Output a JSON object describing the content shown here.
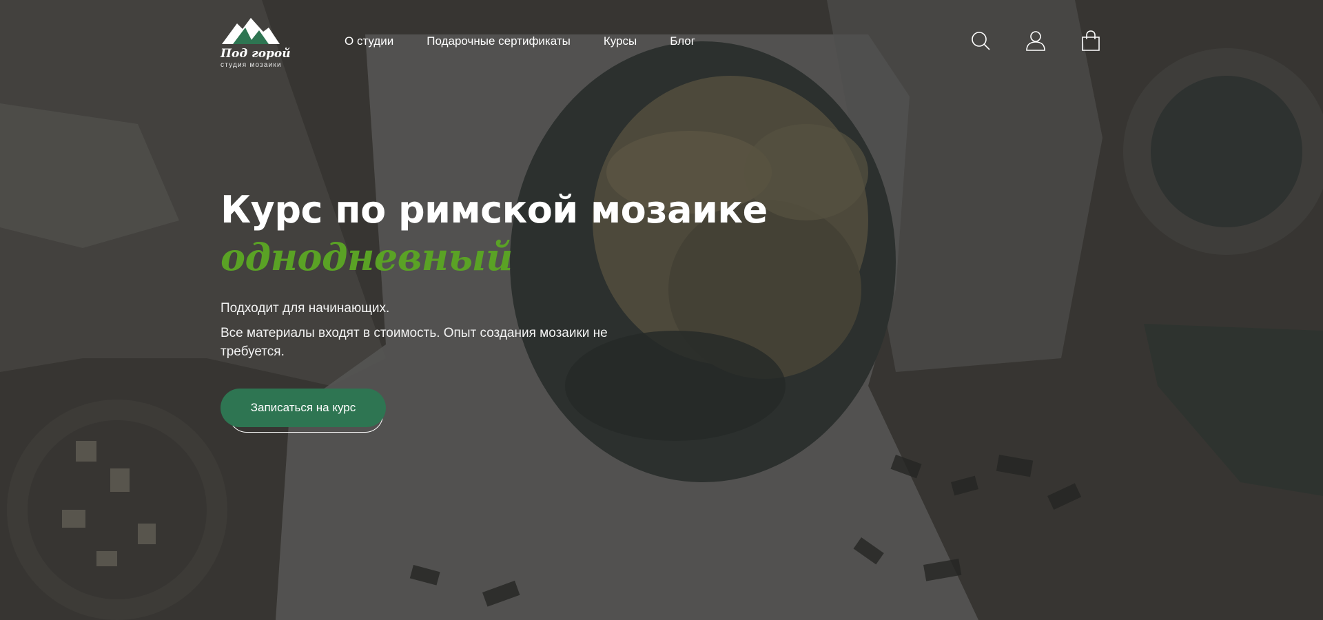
{
  "brand": {
    "name": "Под горой",
    "tagline": "студия мозаики",
    "accent_color": "#5aa225",
    "button_color": "#2e7552"
  },
  "nav": {
    "items": [
      {
        "label": "О студии"
      },
      {
        "label": "Подарочные сертификаты"
      },
      {
        "label": "Курсы"
      },
      {
        "label": "Блог"
      }
    ]
  },
  "header_icons": [
    "search-icon",
    "user-icon",
    "shopping-bag-icon"
  ],
  "hero": {
    "title": "Курс по римской мозаике",
    "accent": "однодневный",
    "paragraph_1": "Подходит для начинающих.",
    "paragraph_2": "Все материалы входят в стоимость. Опыт создания мозаики не требуется.",
    "cta_label": "Записаться на курс"
  }
}
